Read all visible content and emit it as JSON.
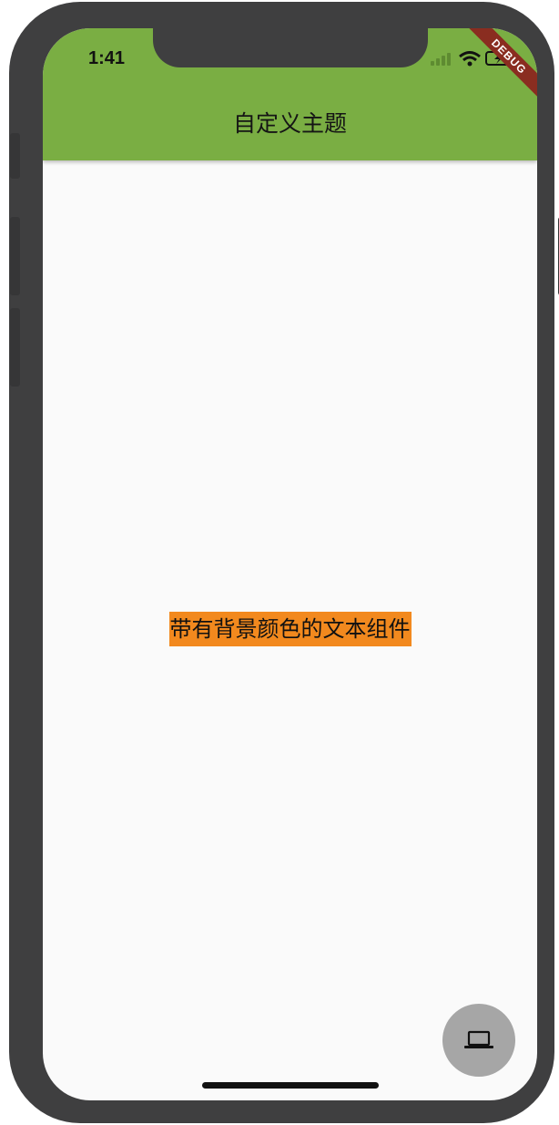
{
  "status_bar": {
    "time": "1:41",
    "signal_icon": "cellular-signal-icon",
    "wifi_icon": "wifi-icon",
    "battery_icon": "battery-charging-icon"
  },
  "debug_banner": {
    "label": "DEBUG"
  },
  "app_bar": {
    "title": "自定义主题",
    "background_color": "#7aae43"
  },
  "body": {
    "text": "带有背景颜色的文本组件",
    "text_background_color": "#f2891e"
  },
  "fab": {
    "icon": "laptop-icon",
    "background_color": "#a6a6a6"
  }
}
